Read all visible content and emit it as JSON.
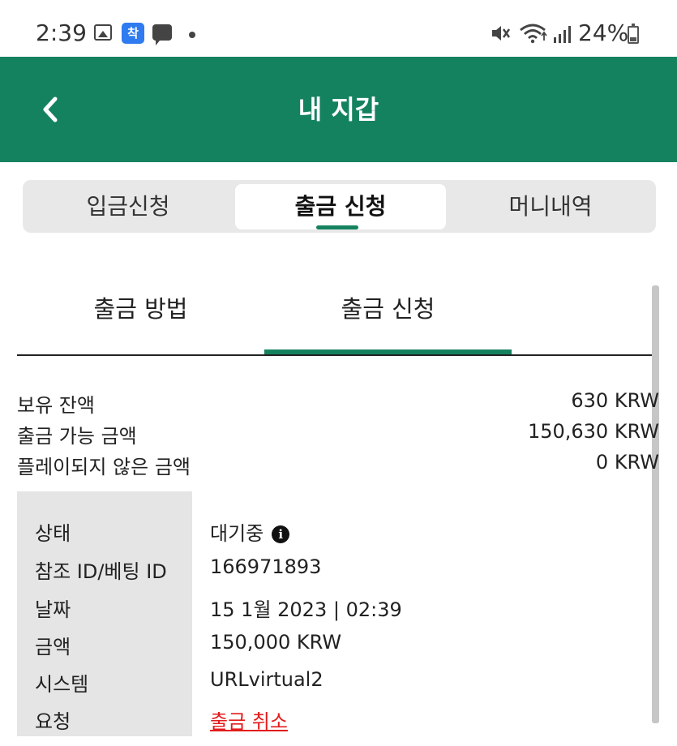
{
  "status_bar": {
    "time": "2:39",
    "app_badge": "착",
    "battery": "24%"
  },
  "header": {
    "title": "내 지갑"
  },
  "segments": {
    "tabs": [
      "입금신청",
      "출금 신청",
      "머니내역"
    ],
    "active_index": 1
  },
  "subtabs": {
    "items": [
      "출금 방법",
      "출금 신청"
    ],
    "active_index": 1
  },
  "balances": [
    {
      "label": "보유 잔액",
      "value": "630 KRW"
    },
    {
      "label": "출금 가능 금액",
      "value": "150,630 KRW"
    },
    {
      "label": "플레이되지 않은 금액",
      "value": "0 KRW"
    }
  ],
  "details": [
    {
      "label": "상태",
      "value": "대기중"
    },
    {
      "label": "참조 ID/베팅 ID",
      "value": "166971893"
    },
    {
      "label": "날짜",
      "value": "15 1월 2023 | 02:39"
    },
    {
      "label": "금액",
      "value": "150,000 KRW"
    },
    {
      "label": "시스템",
      "value": "URLvirtual2"
    },
    {
      "label": "요청",
      "value": "출금 취소"
    }
  ],
  "colors": {
    "brand_green": "#15825f",
    "cancel_red": "#e31b1b"
  },
  "icons": {
    "back": "chevron-left-icon",
    "info": "info-icon"
  }
}
